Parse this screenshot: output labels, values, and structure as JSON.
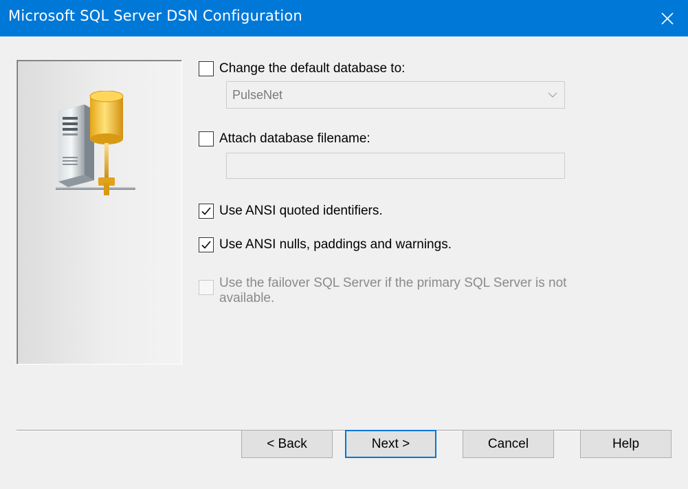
{
  "window": {
    "title": "Microsoft SQL Server DSN Configuration",
    "close_label": "✕"
  },
  "colors": {
    "titlebar": "#0078d7",
    "dialog_bg": "#f0f0f0",
    "disabled_text": "#8a8a8a"
  },
  "side_panel": {
    "icon": "database-server-icon"
  },
  "options": {
    "change_db": {
      "label": "Change the default database to:",
      "checked": false,
      "dropdown_value": "PulseNet"
    },
    "attach_db": {
      "label": "Attach database filename:",
      "checked": false,
      "filename_value": ""
    },
    "ansi_quoted": {
      "label": "Use ANSI quoted identifiers.",
      "checked": true
    },
    "ansi_nulls": {
      "label": "Use ANSI nulls, paddings and warnings.",
      "checked": true
    },
    "failover": {
      "label": "Use the failover SQL Server if the primary SQL Server is not available.",
      "checked": false,
      "enabled": false
    }
  },
  "buttons": {
    "back": "< Back",
    "next": "Next >",
    "cancel": "Cancel",
    "help": "Help"
  }
}
